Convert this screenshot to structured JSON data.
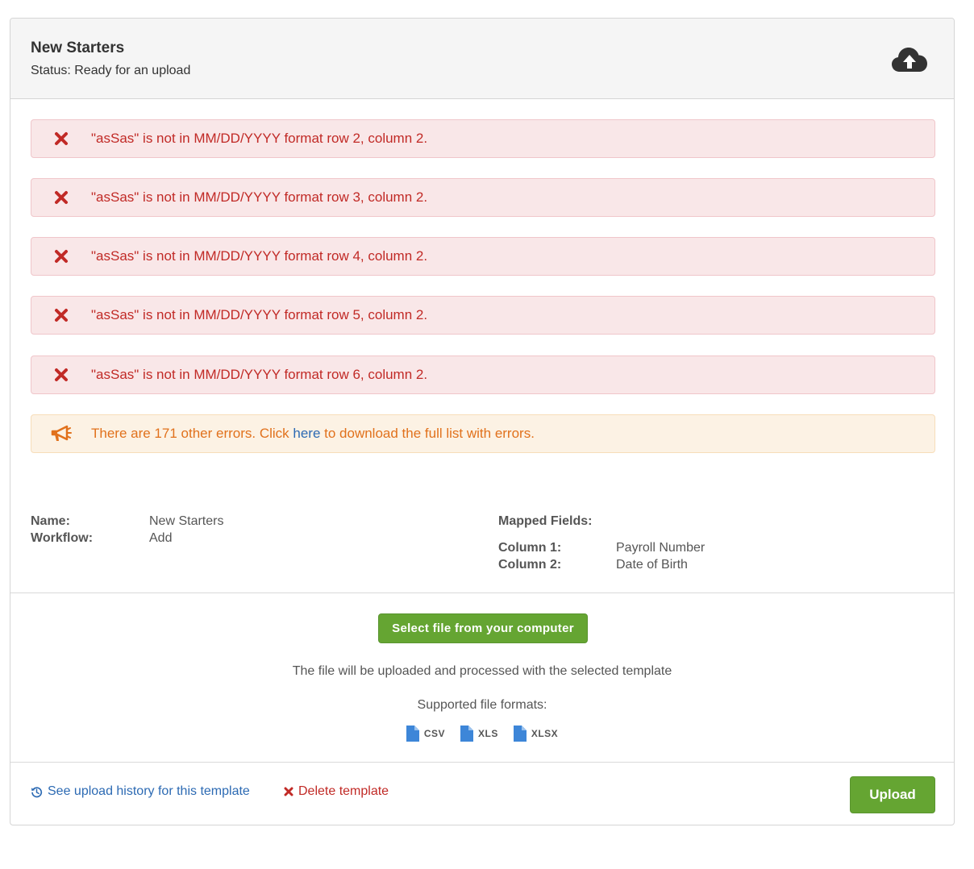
{
  "panel": {
    "title": "New Starters",
    "status": "Status: Ready for an upload",
    "upload_icon": "cloud-upload-icon"
  },
  "errors": [
    "\"asSas\" is not in MM/DD/YYYY format row 2, column 2.",
    "\"asSas\" is not in MM/DD/YYYY format row 3, column 2.",
    "\"asSas\" is not in MM/DD/YYYY format row 4, column 2.",
    "\"asSas\" is not in MM/DD/YYYY format row 5, column 2.",
    "\"asSas\" is not in MM/DD/YYYY format row 6, column 2."
  ],
  "warning": {
    "prefix": "There are 171 other errors. Click ",
    "link": "here",
    "suffix": " to download the full list with errors.",
    "icon": "megaphone-icon"
  },
  "details": {
    "name_label": "Name:",
    "name_value": "New Starters",
    "workflow_label": "Workflow:",
    "workflow_value": "Add",
    "mapped_label": "Mapped Fields:",
    "columns": [
      {
        "label": "Column 1:",
        "value": "Payroll Number"
      },
      {
        "label": "Column 2:",
        "value": "Date of Birth"
      }
    ]
  },
  "upload_area": {
    "select_button": "Select file from your computer",
    "info": "The file will be uploaded and processed with the selected template",
    "formats_label": "Supported file formats:",
    "formats": [
      "CSV",
      "XLS",
      "XLSX"
    ]
  },
  "footer": {
    "history_link": "See upload history for this template",
    "delete_link": "Delete template",
    "upload_button": "Upload"
  },
  "colors": {
    "danger_text": "#c12a26",
    "danger_bg": "#f9e7e8",
    "warning_text": "#e1711c",
    "warning_bg": "#fcf2e4",
    "link": "#2c6ab3",
    "button_green": "#65a532",
    "file_icon": "#3d86d8"
  }
}
